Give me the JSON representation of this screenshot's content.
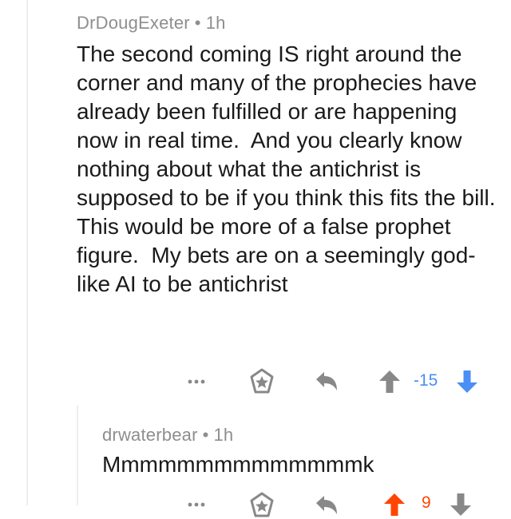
{
  "comments": [
    {
      "author": "DrDougExeter",
      "separator": "•",
      "age": "1h",
      "body": "The second coming IS right around the corner and many of the prophecies have already been fulfilled or are happening now in real time.  And you clearly know nothing about what the antichrist is supposed to be if you think this fits the bill.  This would be more of a false prophet figure.  My bets are on a seemingly god-like AI to be antichrist",
      "score": "-15",
      "vote_state": "downvoted"
    },
    {
      "author": "drwaterbear",
      "separator": "•",
      "age": "1h",
      "body": "Mmmmmmmmmmmmmmk",
      "score": "9",
      "vote_state": "upvoted"
    }
  ],
  "colors": {
    "upvote": "#ff4500",
    "downvote": "#4b8ef5",
    "muted": "#8e8e8e",
    "icon": "#888888",
    "thread_line": "#eeeeee"
  },
  "icons": [
    "more-icon",
    "star-icon",
    "reply-icon",
    "upvote-icon",
    "downvote-icon"
  ]
}
